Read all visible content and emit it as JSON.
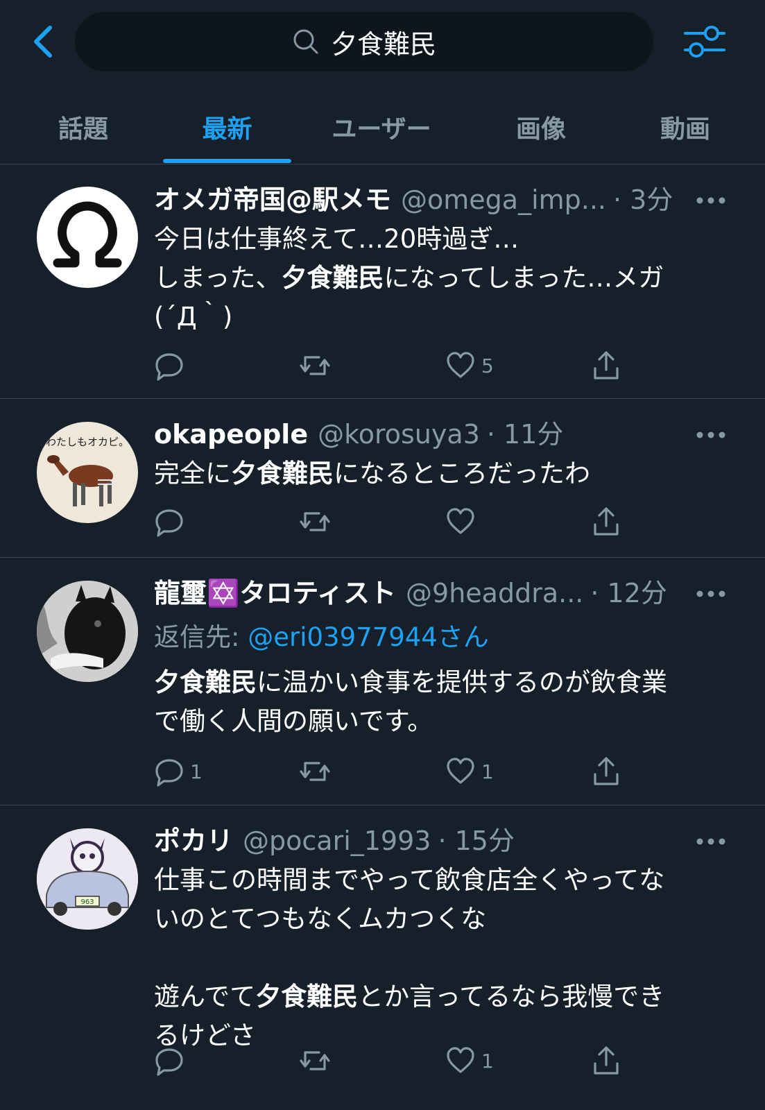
{
  "search": {
    "query": "夕食難民"
  },
  "tabs": [
    {
      "label": "話題",
      "active": false
    },
    {
      "label": "最新",
      "active": true
    },
    {
      "label": "ユーザー",
      "active": false
    },
    {
      "label": "画像",
      "active": false
    },
    {
      "label": "動画",
      "active": false
    }
  ],
  "colors": {
    "background": "#15202b",
    "accent": "#1da1f2",
    "muted": "#8899a6"
  },
  "tweets": [
    {
      "name": "オメガ帝国@駅メモ",
      "handle": "@omega_imp...",
      "time": "· 3分",
      "text_parts": [
        "今日は仕事終えて…20時過ぎ…\nしまった、",
        "夕食難民",
        "になってしまった…メガ\n(´Д｀)"
      ],
      "reply_count": "",
      "like_count": "5",
      "avatar": "omega-symbol"
    },
    {
      "name": "okapeople",
      "handle": "@korosuya3",
      "time": "· 11分",
      "text_parts": [
        "完全に",
        "夕食難民",
        "になるところだったわ"
      ],
      "reply_count": "",
      "like_count": "",
      "avatar": "okapi",
      "avatar_text": "わたしもオカピ。"
    },
    {
      "name": "龍璽✡️タロティスト",
      "handle": "@9headdra...",
      "time": "· 12分",
      "reply_to_label": "返信先:",
      "reply_to_user": "@eri03977944さん",
      "text_parts": [
        "",
        "夕食難民",
        "に温かい食事を提供するのが飲食業\nで働く人間の願いです。"
      ],
      "reply_count": "1",
      "like_count": "1",
      "avatar": "dark-creature"
    },
    {
      "name": "ポカリ",
      "handle": "@pocari_1993",
      "time": "· 15分",
      "text_parts": [
        "仕事この時間までやって飲食店全くやってな\nいのとてつもなくムカつくな\n\n遊んでて",
        "夕食難民",
        "とか言ってるなら我慢でき\nるけどさ"
      ],
      "reply_count": "",
      "like_count": "1",
      "avatar": "character-car",
      "avatar_text": "963"
    }
  ]
}
